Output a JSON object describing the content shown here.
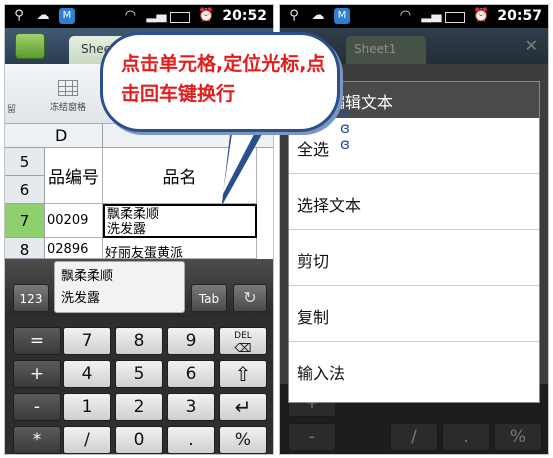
{
  "left": {
    "status": {
      "time": "20:52"
    },
    "sheet_tab": "Sheet1",
    "toolbar": {
      "left_label": "留",
      "freeze_label": "冻结窗格"
    },
    "grid": {
      "column": "D",
      "rows": [
        "5",
        "6",
        "7",
        "8"
      ],
      "header_code": "品编号",
      "header_name": "品名",
      "row7_code": "00209",
      "row7_name": "飘柔柔顺\n洗发露",
      "row8_code": "02896",
      "row8_name": "好丽友蛋黄派"
    },
    "callout": "点击单元格,定位光标,点击回车键换行",
    "input": {
      "btn_123": "123",
      "edit_value": "飘柔柔顺\n洗发露",
      "btn_tab": "Tab"
    },
    "keypad": {
      "row1": [
        "=",
        "7",
        "8",
        "9",
        "DEL"
      ],
      "row2": [
        "+",
        "4",
        "5",
        "6"
      ],
      "row3": [
        "-",
        "1",
        "2",
        "3"
      ],
      "row4": [
        "*",
        "/",
        "0",
        ".",
        "%"
      ]
    }
  },
  "right": {
    "status": {
      "time": "20:57"
    },
    "sheet_tab": "Sheet1",
    "menu": {
      "title": "编辑文本",
      "items": [
        "全选",
        "选择文本",
        "剪切",
        "复制",
        "输入法"
      ]
    },
    "bg_keys": [
      "+",
      "-",
      "/",
      ".",
      "%"
    ]
  },
  "colors": {
    "callout_text": "#e41c1c",
    "callout_border": "#2b4f8e",
    "active_row": "#8dd06d",
    "blue_key": "#1d8fe6"
  },
  "icons": [
    "usb-icon",
    "weather-icon",
    "sync-icon",
    "wifi-icon",
    "signal-icon",
    "battery-icon",
    "alarm-icon"
  ]
}
